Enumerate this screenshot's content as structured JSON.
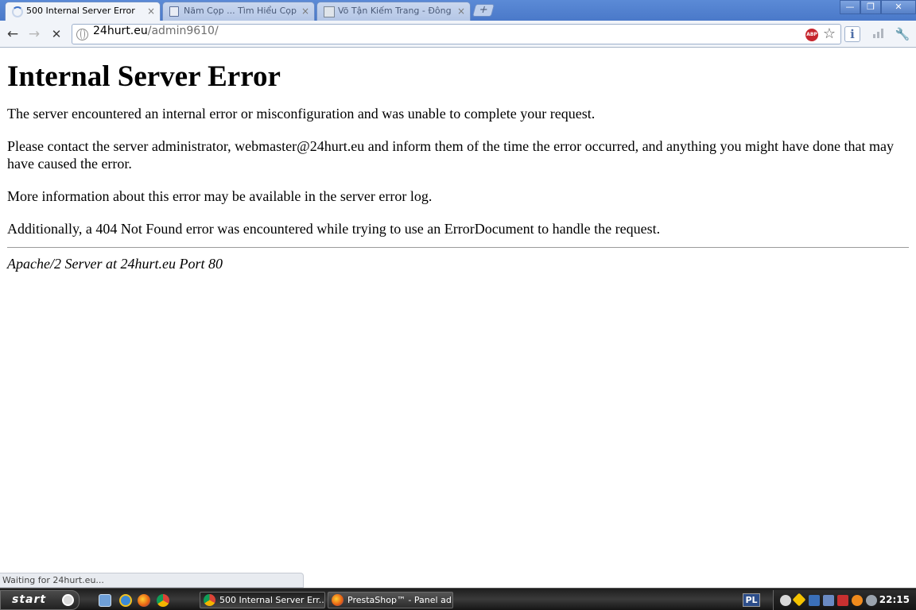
{
  "browser": {
    "tabs": [
      {
        "label": "500 Internal Server Error",
        "active": true,
        "icon": "loading-spinner"
      },
      {
        "label": "Năm Cọp ... Tìm Hiểu Cọp - Tiề",
        "active": false,
        "icon": "page-icon"
      },
      {
        "label": "Võ Tận Kiếm Trang - Đông Phư",
        "active": false,
        "icon": "forum-icon"
      }
    ],
    "tab_close_glyph": "×",
    "newtab_glyph": "+",
    "window_controls": {
      "minimize": "—",
      "restore": "❐",
      "close": "✕"
    },
    "toolbar": {
      "back_glyph": "←",
      "forward_glyph": "→",
      "stop_glyph": "✕",
      "url_host": "24hurt.eu",
      "url_path": "/admin9610/",
      "abp_label": "ABP",
      "star_glyph": "☆",
      "info_glyph": "ℹ",
      "wrench_glyph": "🔧"
    }
  },
  "page": {
    "heading": "Internal Server Error",
    "paragraphs": [
      "The server encountered an internal error or misconfiguration and was unable to complete your request.",
      "Please contact the server administrator, webmaster@24hurt.eu and inform them of the time the error occurred, and anything you might have done that may have caused the error.",
      "More information about this error may be available in the server error log.",
      "Additionally, a 404 Not Found error was encountered while trying to use an ErrorDocument to handle the request."
    ],
    "address": "Apache/2 Server at 24hurt.eu Port 80"
  },
  "status_bubble": "Waiting for 24hurt.eu...",
  "taskbar": {
    "start_label": "start",
    "quick_launch": [
      "desktop-icon",
      "ie-icon",
      "firefox-icon",
      "chrome-icon"
    ],
    "tasks": [
      {
        "label": "500 Internal Server Err...",
        "active": true,
        "icon": "chrome-icon"
      },
      {
        "label": "PrestaShop™ - Panel ad...",
        "active": false,
        "icon": "firefox-icon"
      }
    ],
    "language": "PL",
    "clock": "22:15"
  },
  "colors": {
    "tab_strip": "#4a79c9",
    "toolbar": "#f1f4f9",
    "abp_red": "#c6262e",
    "taskbar": "#1e1e1e"
  }
}
